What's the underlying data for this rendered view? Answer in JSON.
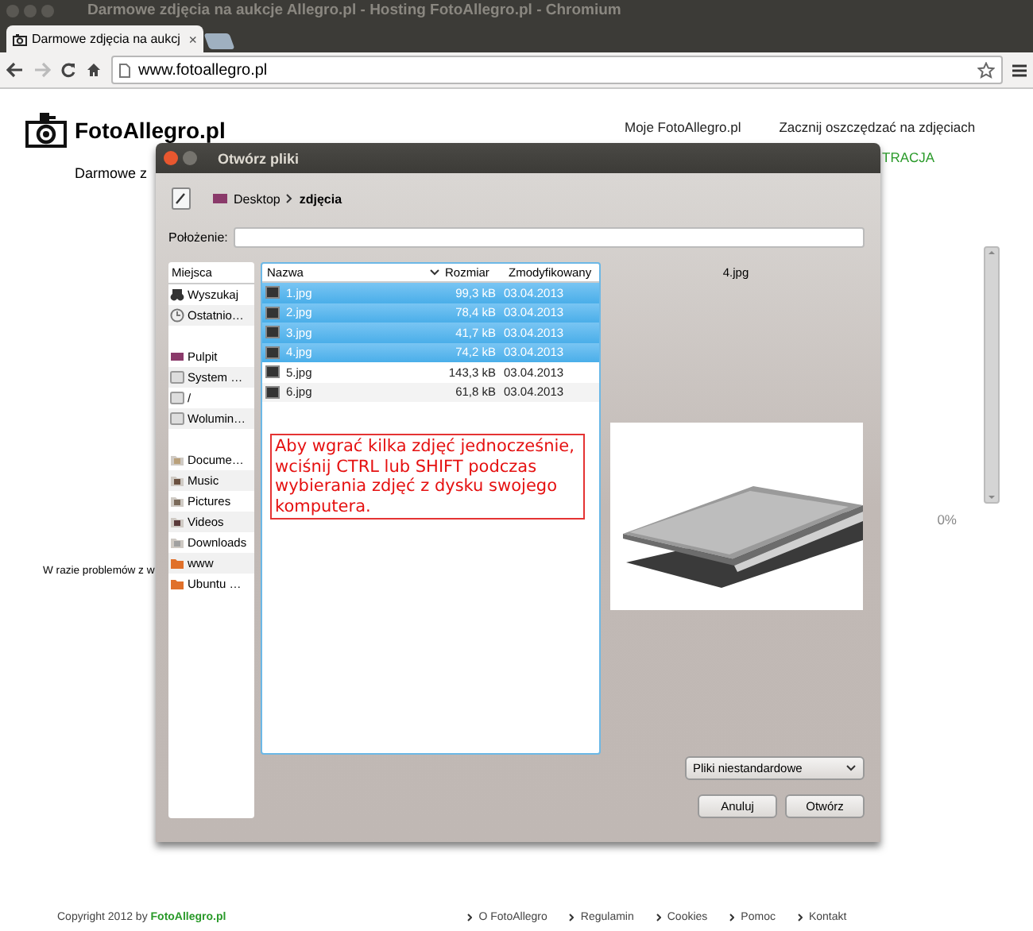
{
  "window": {
    "title": "Darmowe zdjęcia na aukcje Allegro.pl - Hosting FotoAllegro.pl - Chromium"
  },
  "browser": {
    "tabs": [
      {
        "label": "Darmowe zdjęcia na aukcj",
        "close": "×",
        "selected": true
      }
    ],
    "address": "www.fotoallegro.pl"
  },
  "page": {
    "logo": "FotoAllegro.pl",
    "tagline": "Darmowe z",
    "nav": [
      "Moje FotoAllegro.pl",
      "Zacznij oszczędzać na zdjęciach"
    ],
    "register": "TRACJA",
    "notice": "W razie problemów z w",
    "progress": "0%",
    "footer": {
      "copyright": "Copyright 2012 by **FotoAllegro.pl**",
      "links": [
        "O FotoAllegro",
        "Regulamin",
        "Cookies",
        "Pomoc",
        "Kontakt"
      ]
    }
  },
  "dialog": {
    "title": "Otwórz pliki",
    "path": [
      {
        "label": "Desktop",
        "selected": false
      },
      {
        "label": "zdjęcia",
        "selected": true
      }
    ],
    "location_label": "Położenie:",
    "places_header": "Miejsca",
    "places": [
      [
        {
          "label": "Wyszukaj",
          "kind": "search"
        },
        {
          "label": "Ostatnio…",
          "kind": "recent"
        }
      ],
      [
        {
          "label": "Pulpit",
          "kind": "desktop"
        },
        {
          "label": "System …",
          "kind": "drive"
        },
        {
          "label": "/",
          "kind": "drive"
        },
        {
          "label": "Wolumin…",
          "kind": "drive"
        }
      ],
      [
        {
          "label": "Docume…",
          "kind": "docs"
        },
        {
          "label": "Music",
          "kind": "music"
        },
        {
          "label": "Pictures",
          "kind": "pictures"
        },
        {
          "label": "Videos",
          "kind": "videos"
        },
        {
          "label": "Downloads",
          "kind": "downloads"
        },
        {
          "label": "www",
          "kind": "folder"
        },
        {
          "label": "Ubuntu …",
          "kind": "folder"
        }
      ]
    ],
    "columns": [
      "Nazwa",
      "Rozmiar",
      "Zmodyfikowany"
    ],
    "files": [
      {
        "name": "1.jpg",
        "size": "99,3 kB",
        "date": "03.04.2013",
        "selected": true
      },
      {
        "name": "2.jpg",
        "size": "78,4 kB",
        "date": "03.04.2013",
        "selected": true
      },
      {
        "name": "3.jpg",
        "size": "41,7 kB",
        "date": "03.04.2013",
        "selected": true
      },
      {
        "name": "4.jpg",
        "size": "74,2 kB",
        "date": "03.04.2013",
        "selected": true
      },
      {
        "name": "5.jpg",
        "size": "143,3 kB",
        "date": "03.04.2013",
        "selected": false
      },
      {
        "name": "6.jpg",
        "size": "61,8 kB",
        "date": "03.04.2013",
        "selected": false
      }
    ],
    "hint": "Aby wgrać kilka zdjęć jednocześnie, wciśnij CTRL lub SHIFT podczas wybierania zdjęć z dysku swojego komputera.",
    "preview_name": "4.jpg",
    "filter": "Pliki niestandardowe",
    "buttons": [
      "Anuluj",
      "Otwórz"
    ]
  }
}
